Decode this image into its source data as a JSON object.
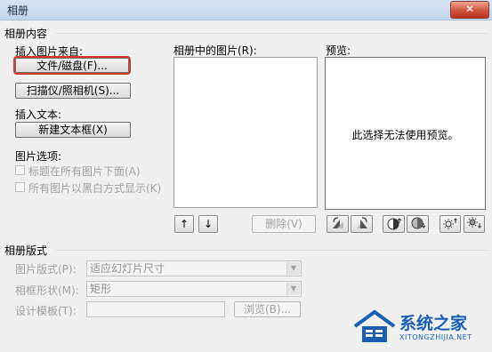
{
  "window": {
    "title": "相册",
    "close_glyph": "✕"
  },
  "album_content": {
    "group_label": "相册内容",
    "insert_picture_from": "插入图片来自:",
    "file_disk_button": "文件/磁盘(F)...",
    "scanner_camera_button": "扫描仪/照相机(S)...",
    "insert_text": "插入文本:",
    "new_textbox_button": "新建文本框(X)",
    "picture_options": "图片选项:",
    "option_captions": "标题在所有图片下面(A)",
    "option_blackwhite": "所有图片以黑白方式显示(K)",
    "pictures_in_album": "相册中的图片(R):",
    "remove_button": "删除(V)",
    "preview_label": "预览:",
    "preview_message": "此选择无法使用预览。"
  },
  "album_layout": {
    "group_label": "相册版式",
    "picture_layout_label": "图片版式(P):",
    "picture_layout_value": "适应幻灯片尺寸",
    "frame_shape_label": "相框形状(M):",
    "frame_shape_value": "矩形",
    "design_template_label": "设计模板(T):",
    "design_template_value": "",
    "browse_button": "浏览(B)..."
  },
  "watermark": {
    "brand": "系统之家",
    "url": "XITONGZHIJIA.NET"
  },
  "colors": {
    "focus_border": "#d03a2c",
    "title_bar": "#c2d3ea",
    "watermark_blue": "#1a5fb4"
  }
}
